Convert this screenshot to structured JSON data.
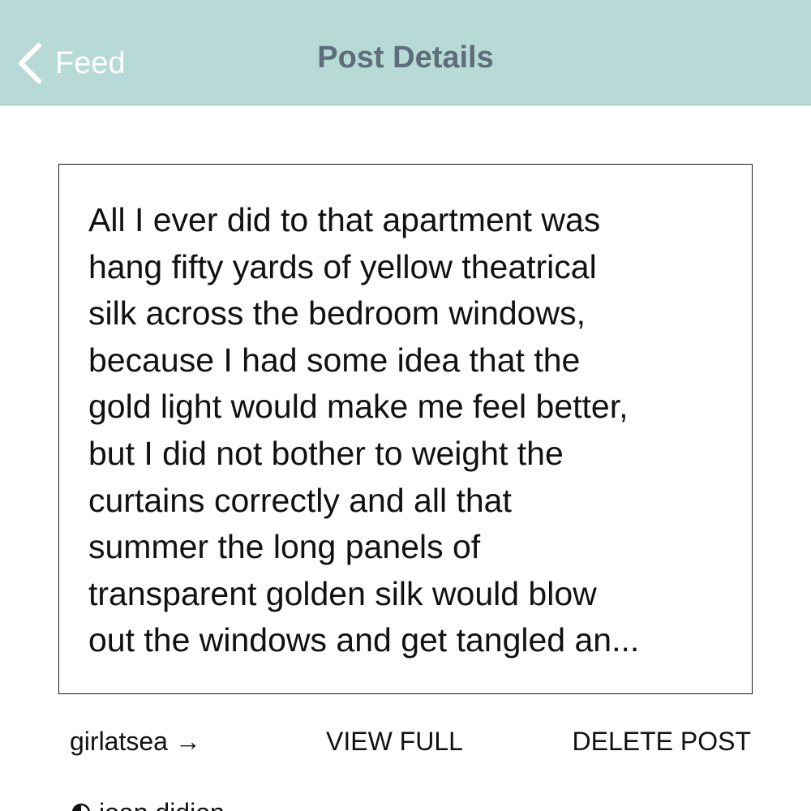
{
  "nav": {
    "back_label": "Feed",
    "title": "Post Details",
    "background_color": "#b7dad6",
    "title_color": "#5d6d7a"
  },
  "post": {
    "text": "All I ever did to that apartment was\nhang fifty yards of yellow theatrical\nsilk across the bedroom windows,\nbecause I had some idea that the\ngold light would make me feel better,\nbut I did not bother to weight the\ncurtains correctly and all that\nsummer the long panels of\ntransparent golden silk would blow\nout the windows and get tangled an..."
  },
  "actions": {
    "author": "girlatsea →",
    "view_full": "VIEW FULL",
    "delete_post": "DELETE POST"
  },
  "below": {
    "icon": "half-circle-icon",
    "label": "joan didion"
  }
}
